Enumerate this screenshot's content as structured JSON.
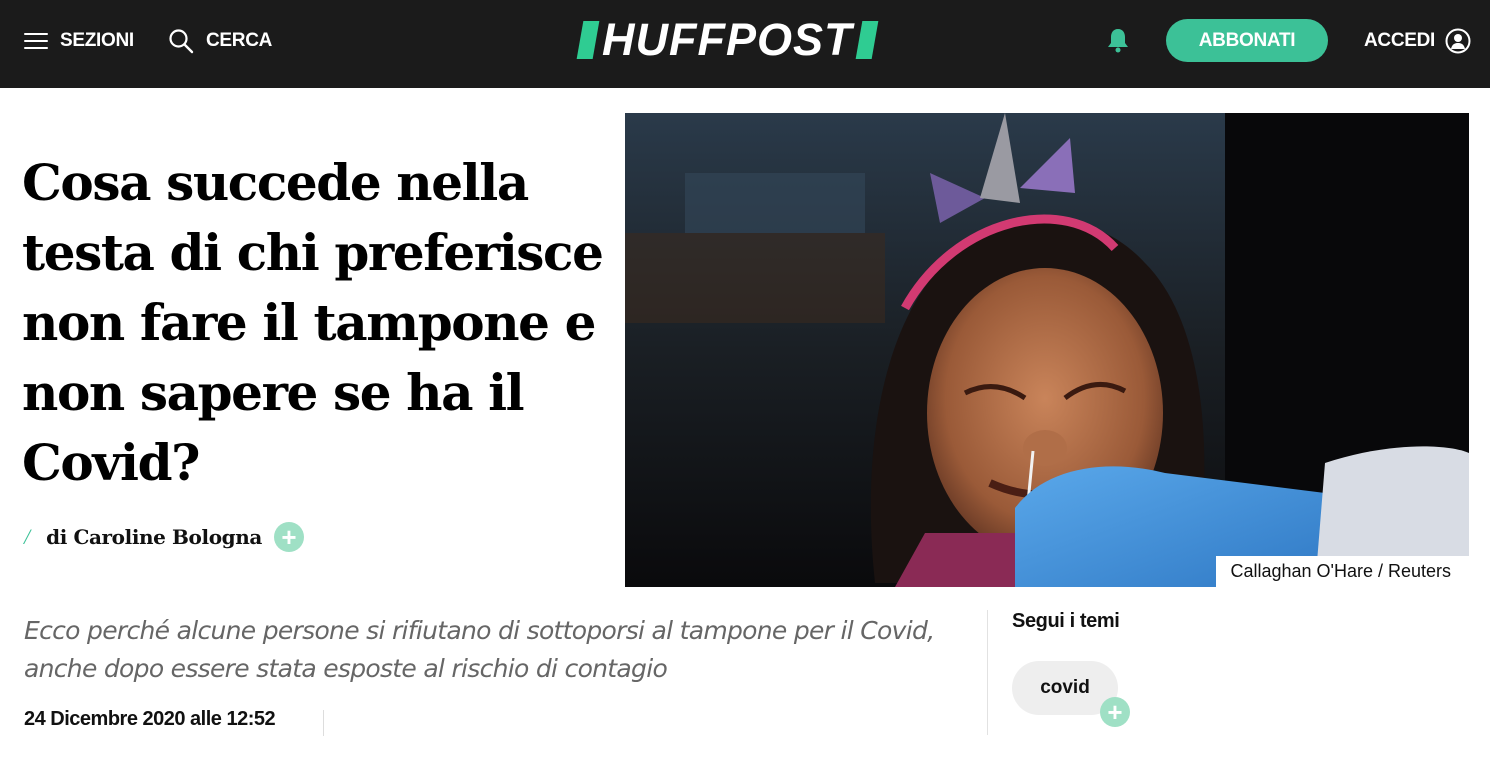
{
  "header": {
    "sections_label": "SEZIONI",
    "search_label": "CERCA",
    "logo_text": "HUFFPOST",
    "subscribe_label": "ABBONATI",
    "login_label": "ACCEDI",
    "brand_color": "#3cc197",
    "bar_color": "#1b1b1b"
  },
  "article": {
    "headline": "Cosa succede nella testa di chi preferisce non fare il tampone e non sapere se ha il Covid?",
    "byline_prefix": "/",
    "author": "di Caroline Bologna",
    "photo_credit": "Callaghan O'Hare / Reuters",
    "subhead": "Ecco perché alcune persone si rifiutano di sottoporsi al tampone per il Covid, anche dopo essere stata esposte al rischio di contagio",
    "date": "24 Dicembre 2020 alle 12:52"
  },
  "topics": {
    "title": "Segui i temi",
    "items": [
      {
        "label": "covid"
      }
    ]
  },
  "icons": {
    "menu": "hamburger-icon",
    "search": "search-icon",
    "notifications": "bell-icon",
    "account": "user-icon",
    "follow": "plus-icon"
  }
}
